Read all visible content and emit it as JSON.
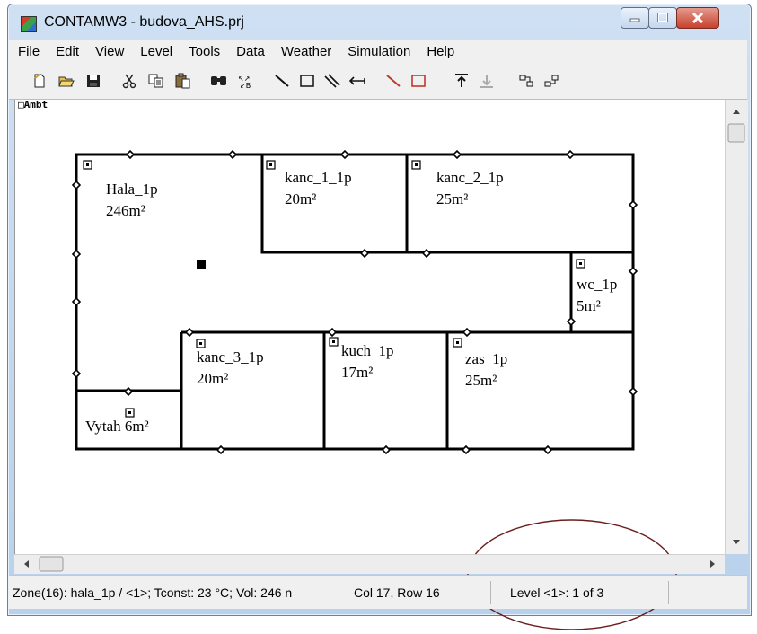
{
  "window": {
    "title": "CONTAMW3 - budova_AHS.prj"
  },
  "menu": [
    {
      "label": "File"
    },
    {
      "label": "Edit"
    },
    {
      "label": "View"
    },
    {
      "label": "Level"
    },
    {
      "label": "Tools"
    },
    {
      "label": "Data"
    },
    {
      "label": "Weather"
    },
    {
      "label": "Simulation"
    },
    {
      "label": "Help"
    }
  ],
  "canvas": {
    "ambient_label": "□Ambt"
  },
  "zones": [
    {
      "name": "Hala_1p",
      "area": "246m²"
    },
    {
      "name": "kanc_1_1p",
      "area": "20m²"
    },
    {
      "name": "kanc_2_1p",
      "area": "25m²"
    },
    {
      "name": "wc_1p",
      "area": "5m²"
    },
    {
      "name": "kanc_3_1p",
      "area": "20m²"
    },
    {
      "name": "kuch_1p",
      "area": "17m²"
    },
    {
      "name": "zas_1p",
      "area": "25m²"
    },
    {
      "name": "Vytah",
      "area": "6m²"
    }
  ],
  "status": {
    "zone_info": "Zone(16): hala_1p / <1>; Tconst: 23 °C; Vol: 246 n",
    "position": "Col 17, Row 16",
    "level": "Level <1>: 1 of 3"
  },
  "icons": [
    "app-icon",
    "new-icon",
    "open-icon",
    "save-icon",
    "cut-icon",
    "copy-icon",
    "paste-icon",
    "find-icon",
    "flow-path-icon",
    "wall-line-icon",
    "zone-rect-icon",
    "duct-icon",
    "arrow-icon",
    "red-line-icon",
    "red-rect-icon",
    "level-up-icon",
    "level-down-icon",
    "view-a-icon",
    "view-b-icon"
  ]
}
